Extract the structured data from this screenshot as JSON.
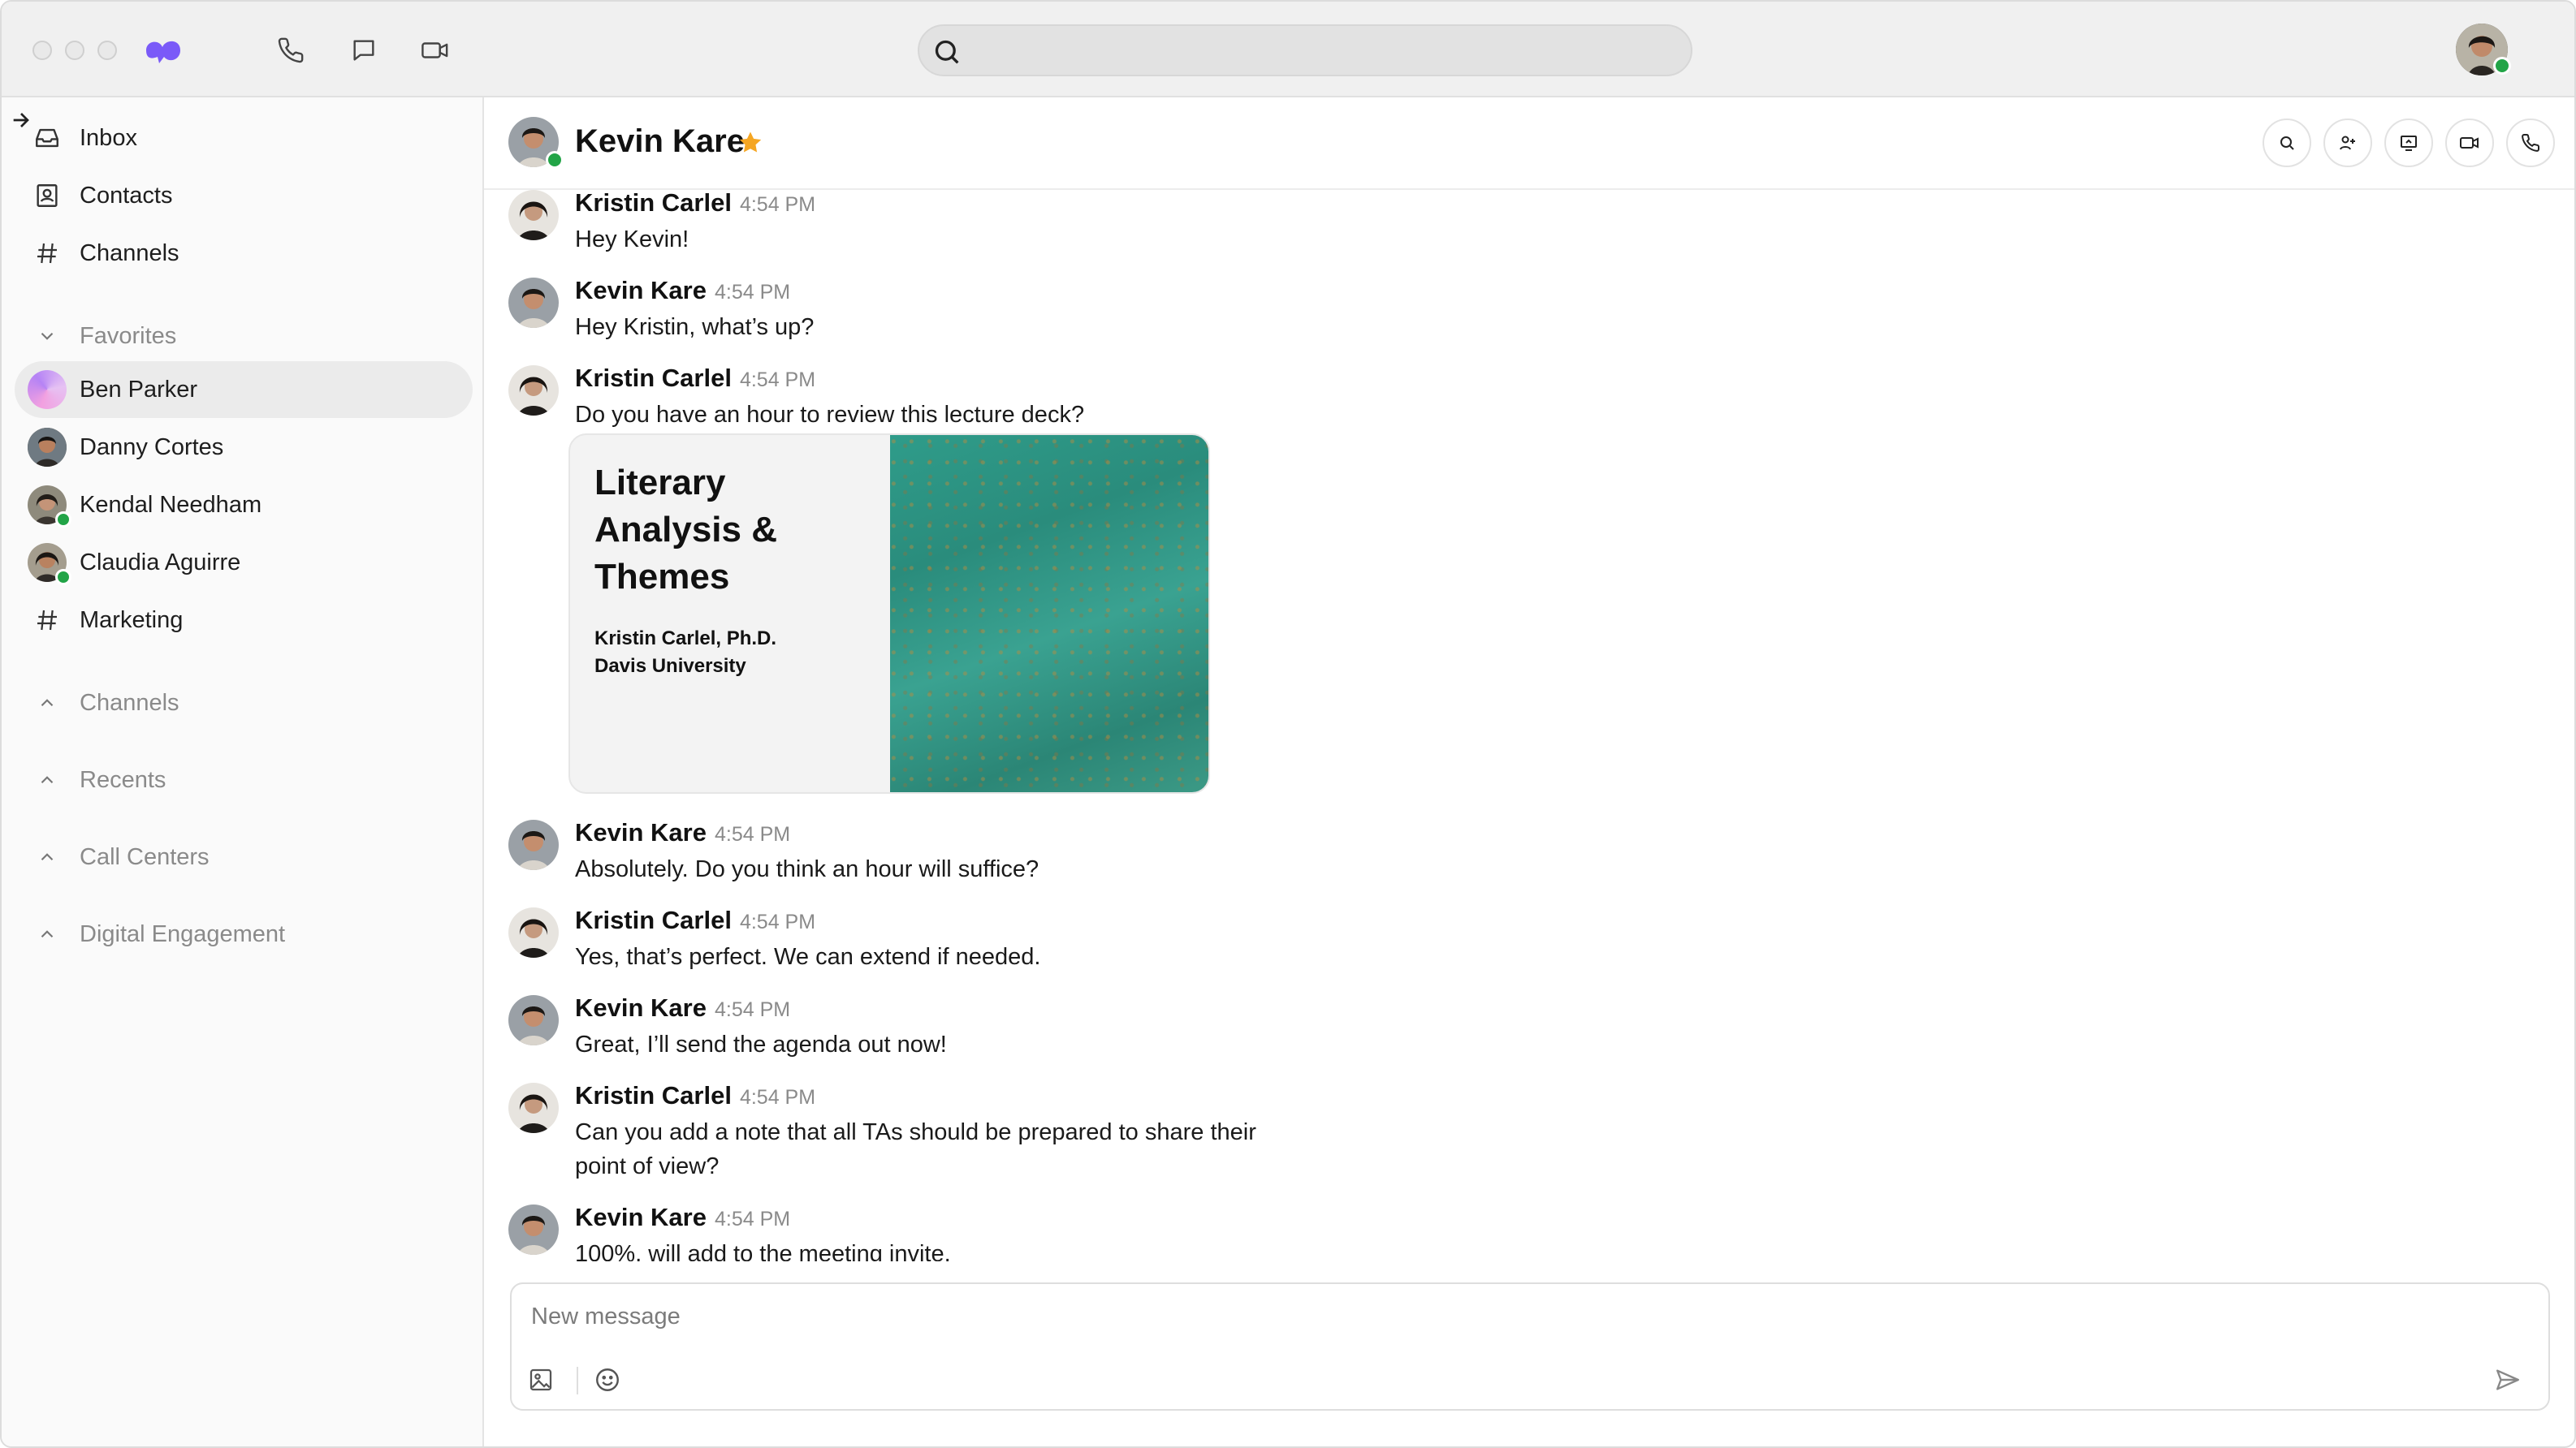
{
  "app": {
    "brand_color": "#7a5af8",
    "presence_color": "#22a447",
    "star_color": "#f5a623"
  },
  "search": {
    "placeholder": ""
  },
  "sidebar": {
    "nav": [
      {
        "label": "Inbox",
        "icon": "inbox-icon"
      },
      {
        "label": "Contacts",
        "icon": "contacts-icon"
      },
      {
        "label": "Channels",
        "icon": "hash-icon"
      }
    ],
    "favorites_label": "Favorites",
    "favorites": [
      {
        "label": "Ben Parker",
        "icon": "avatar",
        "active": true
      },
      {
        "label": "Danny Cortes",
        "icon": "avatar"
      },
      {
        "label": "Kendal Needham",
        "icon": "avatar",
        "online": true
      },
      {
        "label": "Claudia Aguirre",
        "icon": "avatar",
        "online": true
      },
      {
        "label": "Marketing",
        "icon": "hash-icon"
      }
    ],
    "sections": [
      {
        "label": "Channels"
      },
      {
        "label": "Recents"
      },
      {
        "label": "Call Centers"
      },
      {
        "label": "Digital Engagement"
      }
    ]
  },
  "chat": {
    "contact_name": "Kevin Kare",
    "messages": [
      {
        "name": "Kristin Carlel",
        "time": "4:54 PM",
        "text": "Hey Kevin!"
      },
      {
        "name": "Kevin Kare",
        "time": "4:54 PM",
        "text": "Hey Kristin, what’s up?"
      },
      {
        "name": "Kristin Carlel",
        "time": "4:54 PM",
        "text": "Do you have an hour to review this lecture deck?"
      },
      {
        "name": "Kevin Kare",
        "time": "4:54 PM",
        "text": "Absolutely. Do you think an hour will suffice?"
      },
      {
        "name": "Kristin Carlel",
        "time": "4:54 PM",
        "text": "Yes, that’s perfect. We can extend if needed."
      },
      {
        "name": "Kevin Kare",
        "time": "4:54 PM",
        "text": "Great, I’ll send the agenda out now!"
      },
      {
        "name": "Kristin Carlel",
        "time": "4:54 PM",
        "text": "Can you add a note that all TAs should be prepared to share their point of view?"
      },
      {
        "name": "Kevin Kare",
        "time": "4:54 PM",
        "text": "100%, will add to the meeting invite."
      }
    ],
    "attachment": {
      "title_lines": [
        "Literary",
        "Analysis &",
        "Themes"
      ],
      "author": "Kristin Carlel, Ph.D.",
      "institution": "Davis University"
    }
  },
  "composer": {
    "placeholder": "New message"
  }
}
